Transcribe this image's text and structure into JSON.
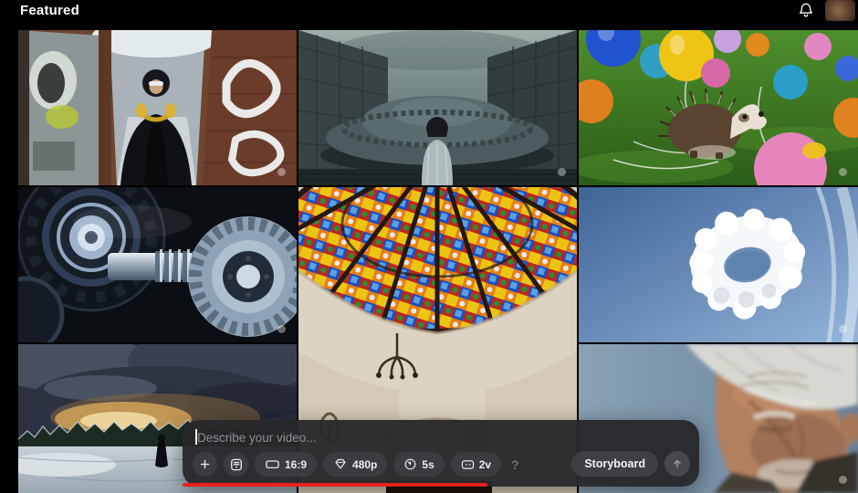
{
  "header": {
    "title": "Featured"
  },
  "composer": {
    "placeholder": "Describe your video...",
    "aspect_label": "16:9",
    "resolution_label": "480p",
    "duration_label": "5s",
    "variations_label": "2v",
    "help_label": "?",
    "storyboard_label": "Storyboard",
    "progress_percent": 59,
    "accent_color": "#e8211a"
  },
  "tiles": [
    {
      "description": "Person in black jacket with gold headphones looking up in a graffiti-covered alley"
    },
    {
      "description": "Figure in a silver jacket facing a giant saucer-shaped building between two towers"
    },
    {
      "description": "Hedgehog on green grass surrounded by colorful balloons"
    },
    {
      "description": "Close-up of chrome engine gears and a ribbed shaft"
    },
    {
      "description": "Colorful stained glass dome ceiling above a cream room with arched window and chandelier"
    },
    {
      "description": "Ring-shaped cloud floating in a blue sky"
    },
    {
      "description": "Lone figure walking on snow under a stormy golden sunset sky"
    },
    {
      "description": "Close-up of an elderly man with white hair looking down"
    }
  ]
}
